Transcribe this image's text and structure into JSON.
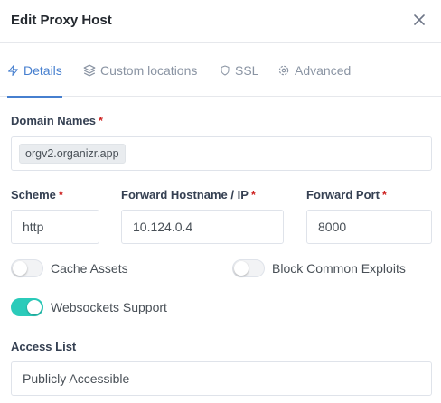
{
  "dialog": {
    "title": "Edit Proxy Host",
    "close_icon": "close-icon"
  },
  "tabs": [
    {
      "label": "Details",
      "icon": "zap-icon",
      "active": true
    },
    {
      "label": "Custom locations",
      "icon": "layers-icon",
      "active": false
    },
    {
      "label": "SSL",
      "icon": "shield-icon",
      "active": false
    },
    {
      "label": "Advanced",
      "icon": "gear-icon",
      "active": false
    }
  ],
  "form": {
    "domain_names": {
      "label": "Domain Names",
      "required_mark": "*",
      "chips": [
        "orgv2.organizr.app"
      ]
    },
    "scheme": {
      "label": "Scheme",
      "required_mark": "*",
      "value": "http"
    },
    "forward_host": {
      "label": "Forward Hostname / IP",
      "required_mark": "*",
      "value": "10.124.0.4"
    },
    "forward_port": {
      "label": "Forward Port",
      "required_mark": "*",
      "value": "8000"
    },
    "toggles": [
      {
        "label": "Cache Assets",
        "on": false
      },
      {
        "label": "Block Common Exploits",
        "on": false
      },
      {
        "label": "Websockets Support",
        "on": true
      }
    ],
    "access_list": {
      "label": "Access List",
      "value": "Publicly Accessible"
    }
  },
  "colors": {
    "accent": "#467fcf",
    "toggle_on": "#2bcbba",
    "required": "#cd201f"
  }
}
